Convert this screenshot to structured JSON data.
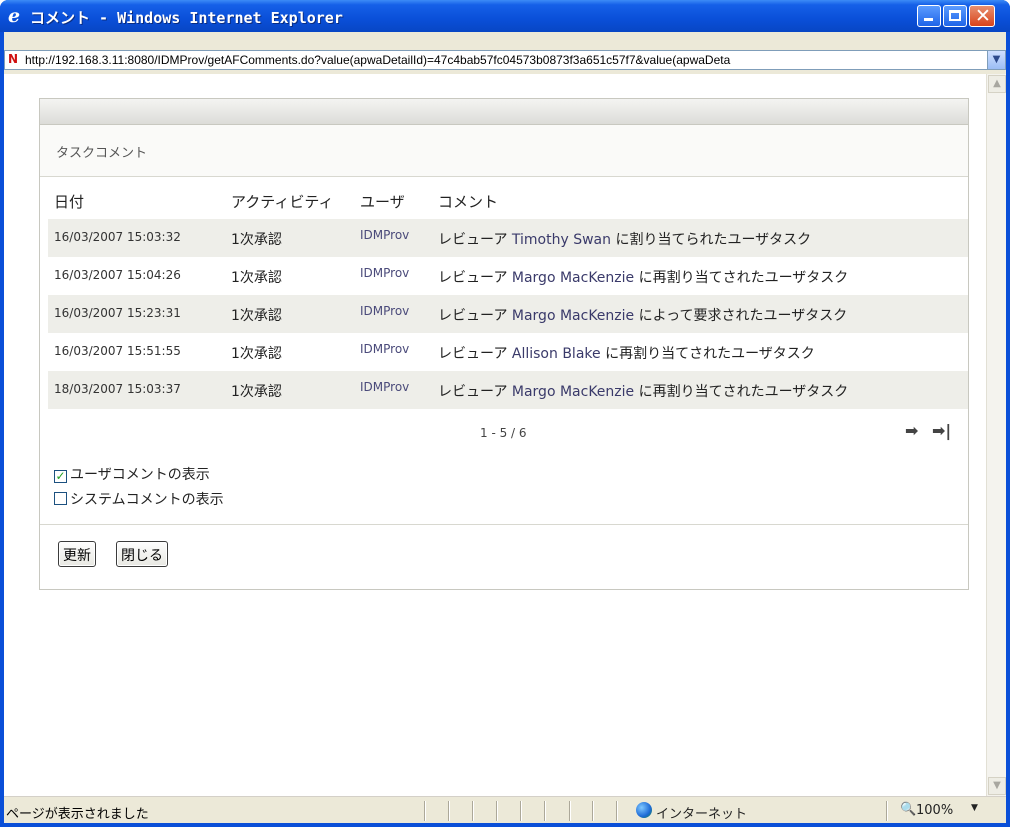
{
  "window": {
    "title": "コメント - Windows Internet Explorer",
    "url": "http://192.168.3.11:8080/IDMProv/getAFComments.do?value(apwaDetailId)=47c4bab57fc04573b0873f3a651c57f7&value(apwaDeta"
  },
  "panel": {
    "subtitle": "タスクコメント",
    "columns": {
      "date": "日付",
      "activity": "アクティビティ",
      "user": "ユーザ",
      "comment": "コメント"
    },
    "rows": [
      {
        "date": "16/03/2007 15:03:32",
        "activity": "1次承認",
        "user": "IDMProv",
        "pre": "レビューア ",
        "name": "Timothy Swan",
        "post": " に割り当てられたユーザタスク"
      },
      {
        "date": "16/03/2007 15:04:26",
        "activity": "1次承認",
        "user": "IDMProv",
        "pre": "レビューア ",
        "name": "Margo MacKenzie",
        "post": " に再割り当てされたユーザタスク"
      },
      {
        "date": "16/03/2007 15:23:31",
        "activity": "1次承認",
        "user": "IDMProv",
        "pre": "レビューア ",
        "name": "Margo MacKenzie",
        "post": " によって要求されたユーザタスク"
      },
      {
        "date": "16/03/2007 15:51:55",
        "activity": "1次承認",
        "user": "IDMProv",
        "pre": "レビューア ",
        "name": "Allison Blake",
        "post": " に再割り当てされたユーザタスク"
      },
      {
        "date": "18/03/2007 15:03:37",
        "activity": "1次承認",
        "user": "IDMProv",
        "pre": "レビューア ",
        "name": "Margo MacKenzie",
        "post": " に再割り当てされたユーザタスク"
      }
    ],
    "pager": "1 - 5 / 6",
    "show_user_comments": {
      "label": "ユーザコメントの表示",
      "checked": true
    },
    "show_system_comments": {
      "label": "システムコメントの表示",
      "checked": false
    },
    "refresh_label": "更新",
    "close_label": "閉じる"
  },
  "statusbar": {
    "text": "ページが表示されました",
    "zone": "インターネット",
    "zoom": "100%"
  }
}
